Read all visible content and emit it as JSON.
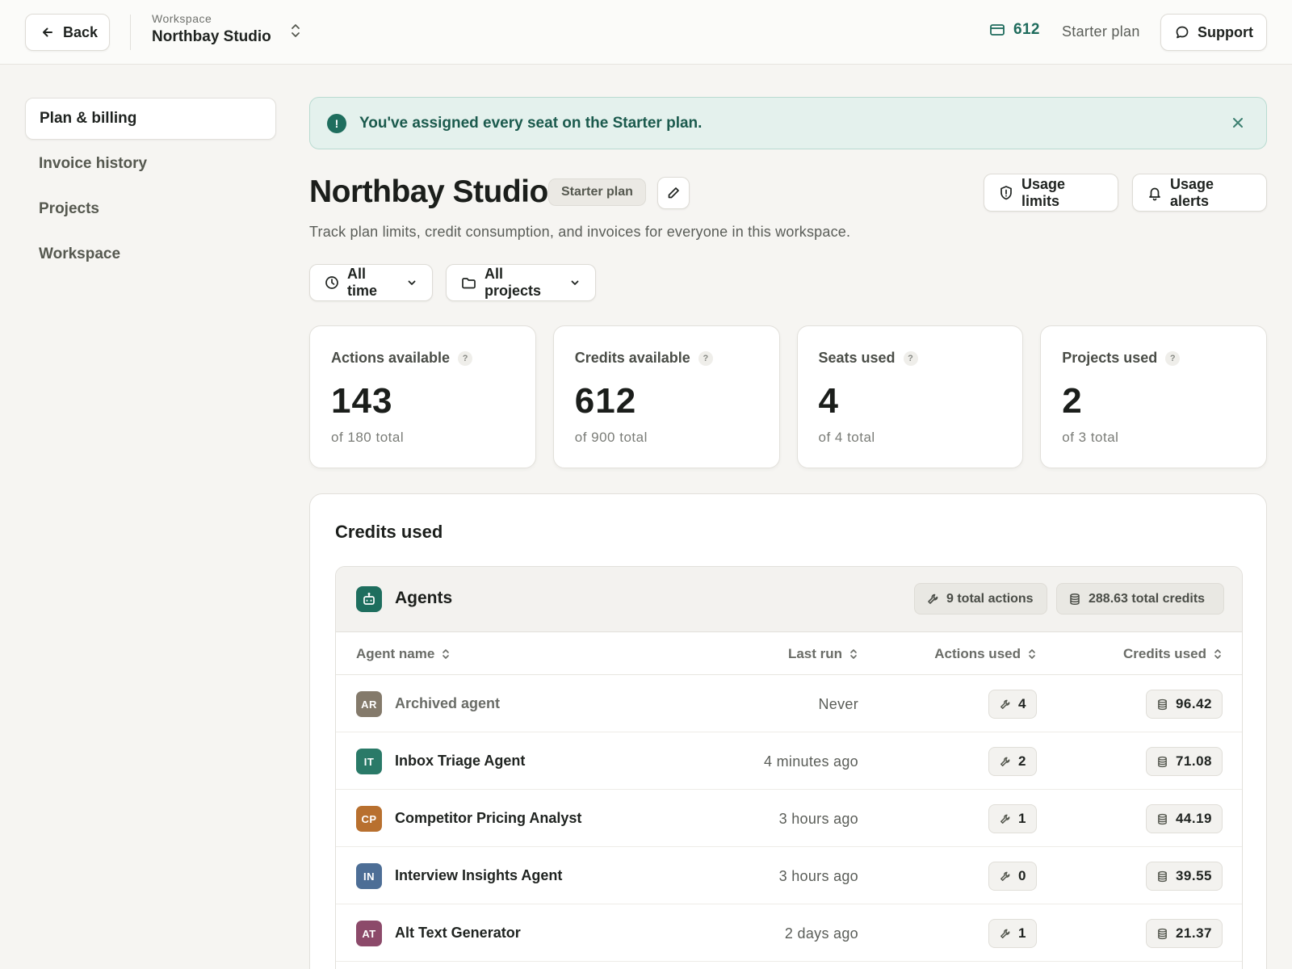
{
  "topbar": {
    "back_label": "Back",
    "workspace_label": "Workspace",
    "workspace_name": "Northbay Studio",
    "credit_count": "612",
    "plan_label": "Starter plan",
    "support_label": "Support"
  },
  "sidebar": {
    "items": [
      {
        "label": "Plan & billing",
        "active": true
      },
      {
        "label": "Invoice history",
        "active": false
      },
      {
        "label": "Projects",
        "active": false
      },
      {
        "label": "Workspace",
        "active": false
      }
    ]
  },
  "banner": {
    "icon": "!",
    "text": "You've assigned every seat on the Starter plan."
  },
  "header": {
    "title": "Northbay Studio",
    "plan_badge": "Starter plan",
    "subtitle": "Track plan limits, credit consumption, and invoices for everyone in this workspace.",
    "usage_limits_label": "Usage limits",
    "usage_alerts_label": "Usage alerts"
  },
  "filters": {
    "time": "All time",
    "projects": "All projects"
  },
  "stats": [
    {
      "label": "Actions available",
      "value": "143",
      "total": "of 180 total"
    },
    {
      "label": "Credits available",
      "value": "612",
      "total": "of 900 total"
    },
    {
      "label": "Seats used",
      "value": "4",
      "total": "of 4 total"
    },
    {
      "label": "Projects used",
      "value": "2",
      "total": "of 3 total"
    }
  ],
  "credits_used": {
    "title": "Credits used",
    "group_title": "Agents",
    "total_actions": "9 total actions",
    "total_credits": "288.63 total credits",
    "columns": {
      "name": "Agent name",
      "last_run": "Last run",
      "actions": "Actions used",
      "credits": "Credits used"
    },
    "rows": [
      {
        "initials": "AR",
        "name": "Archived agent",
        "last_run": "Never",
        "actions": "4",
        "credits": "96.42",
        "color": "#847a6b"
      },
      {
        "initials": "IT",
        "name": "Inbox Triage Agent",
        "last_run": "4 minutes ago",
        "actions": "2",
        "credits": "71.08",
        "color": "#2a7a68"
      },
      {
        "initials": "CP",
        "name": "Competitor Pricing Analyst",
        "last_run": "3 hours ago",
        "actions": "1",
        "credits": "44.19",
        "color": "#b8702f"
      },
      {
        "initials": "IN",
        "name": "Interview Insights Agent",
        "last_run": "3 hours ago",
        "actions": "0",
        "credits": "39.55",
        "color": "#4d6e96"
      },
      {
        "initials": "AT",
        "name": "Alt Text Generator",
        "last_run": "2 days ago",
        "actions": "1",
        "credits": "21.37",
        "color": "#8c4a6a"
      }
    ]
  },
  "colors": {
    "accent": "#1e6b5c",
    "banner_bg": "#e4f1ed",
    "page_bg": "#f6f5f2"
  }
}
